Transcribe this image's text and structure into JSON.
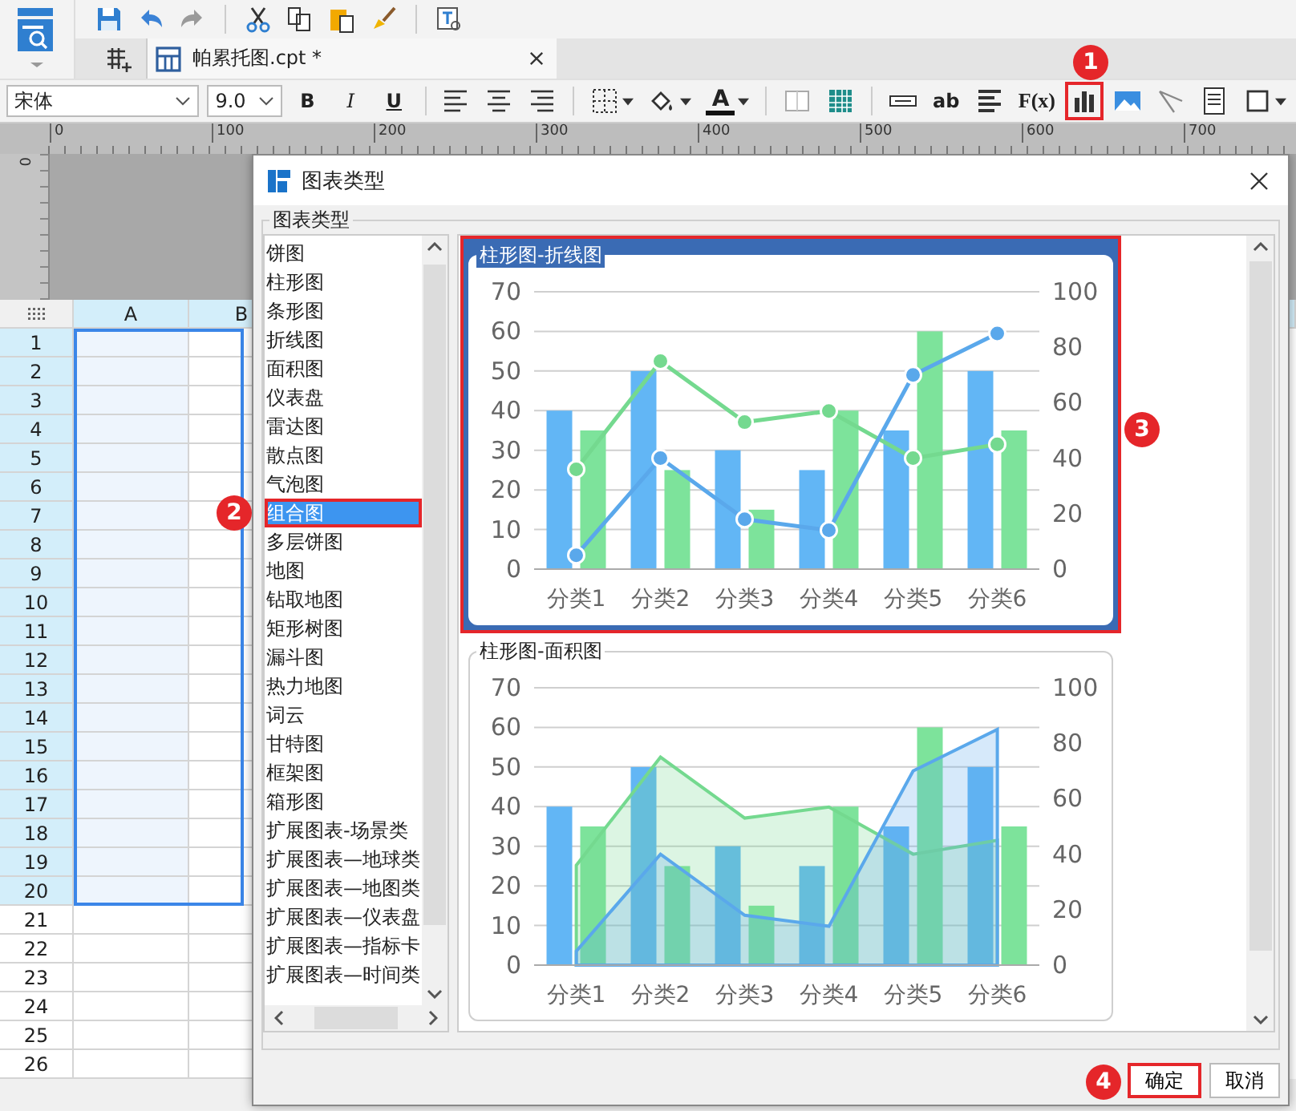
{
  "quick_toolbar": {
    "items": [
      {
        "kind": "save"
      },
      {
        "kind": "undo"
      },
      {
        "kind": "redo"
      },
      {
        "kind": "cut"
      },
      {
        "kind": "copy"
      },
      {
        "kind": "paste"
      },
      {
        "kind": "brush"
      },
      {
        "kind": "preview"
      }
    ]
  },
  "tabs": [
    {
      "label": "帕累托图.cpt *",
      "selected": true
    }
  ],
  "format_toolbar": {
    "font": "宋体",
    "size": "9.0",
    "items": [
      {
        "kind": "bold",
        "label": "B"
      },
      {
        "kind": "italic",
        "label": "I"
      },
      {
        "kind": "underline",
        "label": "U"
      },
      {
        "kind": "align-left"
      },
      {
        "kind": "align-center"
      },
      {
        "kind": "align-right"
      },
      {
        "kind": "border",
        "caret": true
      },
      {
        "kind": "fill",
        "caret": true
      },
      {
        "kind": "font-color",
        "label": "A",
        "caret": true
      },
      {
        "kind": "merge"
      },
      {
        "kind": "grid"
      },
      {
        "kind": "field"
      },
      {
        "kind": "label",
        "label": "ab"
      },
      {
        "kind": "lines"
      },
      {
        "kind": "formula",
        "label": "F(x)"
      },
      {
        "kind": "chart",
        "callout": "1"
      },
      {
        "kind": "image"
      },
      {
        "kind": "slash"
      },
      {
        "kind": "doc"
      },
      {
        "kind": "frame",
        "caret": true
      }
    ]
  },
  "ruler": {
    "labels": [
      "0",
      "100",
      "200",
      "300",
      "400",
      "500",
      "600",
      "700"
    ],
    "vertical_label": "0"
  },
  "sheet": {
    "columns": [
      {
        "label": "A"
      },
      {
        "label": "B"
      }
    ],
    "rows": [
      {
        "label": "1",
        "selected": true
      },
      {
        "label": "2",
        "selected": true
      },
      {
        "label": "3",
        "selected": true
      },
      {
        "label": "4",
        "selected": true
      },
      {
        "label": "5",
        "selected": true
      },
      {
        "label": "6",
        "selected": true
      },
      {
        "label": "7",
        "selected": true
      },
      {
        "label": "8",
        "selected": true
      },
      {
        "label": "9",
        "selected": true
      },
      {
        "label": "10",
        "selected": true
      },
      {
        "label": "11",
        "selected": true
      },
      {
        "label": "12",
        "selected": true
      },
      {
        "label": "13",
        "selected": true
      },
      {
        "label": "14",
        "selected": true
      },
      {
        "label": "15",
        "selected": true
      },
      {
        "label": "16",
        "selected": true
      },
      {
        "label": "17",
        "selected": true
      },
      {
        "label": "18",
        "selected": true
      },
      {
        "label": "19",
        "selected": true
      },
      {
        "label": "20",
        "selected": true
      },
      {
        "label": "21",
        "selected": false
      },
      {
        "label": "22",
        "selected": false
      },
      {
        "label": "23",
        "selected": false
      },
      {
        "label": "24",
        "selected": false
      },
      {
        "label": "25",
        "selected": false
      },
      {
        "label": "26",
        "selected": false
      }
    ]
  },
  "dialog": {
    "title": "图表类型",
    "group_label": "图表类型",
    "chart_types": [
      {
        "label": "饼图",
        "selected": false
      },
      {
        "label": "柱形图",
        "selected": false
      },
      {
        "label": "条形图",
        "selected": false
      },
      {
        "label": "折线图",
        "selected": false
      },
      {
        "label": "面积图",
        "selected": false
      },
      {
        "label": "仪表盘",
        "selected": false
      },
      {
        "label": "雷达图",
        "selected": false
      },
      {
        "label": "散点图",
        "selected": false
      },
      {
        "label": "气泡图",
        "selected": false
      },
      {
        "label": "组合图",
        "selected": true,
        "callout": "2"
      },
      {
        "label": "多层饼图",
        "selected": false
      },
      {
        "label": "地图",
        "selected": false
      },
      {
        "label": "钻取地图",
        "selected": false
      },
      {
        "label": "矩形树图",
        "selected": false
      },
      {
        "label": "漏斗图",
        "selected": false
      },
      {
        "label": "热力地图",
        "selected": false
      },
      {
        "label": "词云",
        "selected": false
      },
      {
        "label": "甘特图",
        "selected": false
      },
      {
        "label": "框架图",
        "selected": false
      },
      {
        "label": "箱形图",
        "selected": false
      },
      {
        "label": "扩展图表-场景类",
        "selected": false
      },
      {
        "label": "扩展图表—地球类",
        "selected": false
      },
      {
        "label": "扩展图表—地图类",
        "selected": false
      },
      {
        "label": "扩展图表—仪表盘",
        "selected": false
      },
      {
        "label": "扩展图表—指标卡",
        "selected": false
      },
      {
        "label": "扩展图表—时间类",
        "selected": false
      }
    ],
    "previews": [
      {
        "selected": true,
        "callout": "3",
        "chart_data": {
          "type": "bar",
          "grid": true,
          "title": "柱形图-折线图",
          "categories": [
            "分类1",
            "分类2",
            "分类3",
            "分类4",
            "分类5",
            "分类6"
          ],
          "ylim": [
            0,
            70
          ],
          "yticks": [
            0,
            10,
            20,
            30,
            40,
            50,
            60,
            70
          ],
          "y2lim": [
            0,
            100
          ],
          "y2ticks": [
            0,
            20,
            40,
            60,
            80,
            100
          ],
          "series": [
            {
              "color": "#62b6f5",
              "values": [
                40,
                50,
                30,
                25,
                35,
                50
              ]
            },
            {
              "color": "#7de39b",
              "values": [
                35,
                25,
                15,
                40,
                60,
                35
              ]
            },
            {
              "type": "line",
              "axis": "y2",
              "marker": true,
              "color": "#74d98f",
              "values": [
                36,
                75,
                53,
                57,
                40,
                45
              ]
            },
            {
              "type": "line",
              "axis": "y2",
              "marker": true,
              "color": "#5aa8eb",
              "values": [
                5,
                40,
                18,
                14,
                70,
                85
              ]
            }
          ]
        }
      },
      {
        "selected": false,
        "chart_data": {
          "type": "bar",
          "grid": true,
          "title": "柱形图-面积图",
          "categories": [
            "分类1",
            "分类2",
            "分类3",
            "分类4",
            "分类5",
            "分类6"
          ],
          "ylim": [
            0,
            70
          ],
          "yticks": [
            0,
            10,
            20,
            30,
            40,
            50,
            60,
            70
          ],
          "y2lim": [
            0,
            100
          ],
          "y2ticks": [
            0,
            20,
            40,
            60,
            80,
            100
          ],
          "series": [
            {
              "color": "#62b6f5",
              "values": [
                40,
                50,
                30,
                25,
                35,
                50
              ]
            },
            {
              "color": "#7de39b",
              "values": [
                35,
                25,
                15,
                40,
                60,
                35
              ]
            },
            {
              "type": "area",
              "axis": "y2",
              "color": "#74d98f",
              "values": [
                36,
                75,
                53,
                57,
                40,
                45
              ]
            },
            {
              "type": "area",
              "axis": "y2",
              "color": "#5aa8eb",
              "values": [
                5,
                40,
                18,
                14,
                70,
                85
              ]
            }
          ]
        }
      }
    ],
    "buttons": [
      {
        "label": "确定",
        "kind": "primary",
        "callout": "4"
      },
      {
        "label": "取消",
        "kind": "secondary"
      }
    ]
  }
}
